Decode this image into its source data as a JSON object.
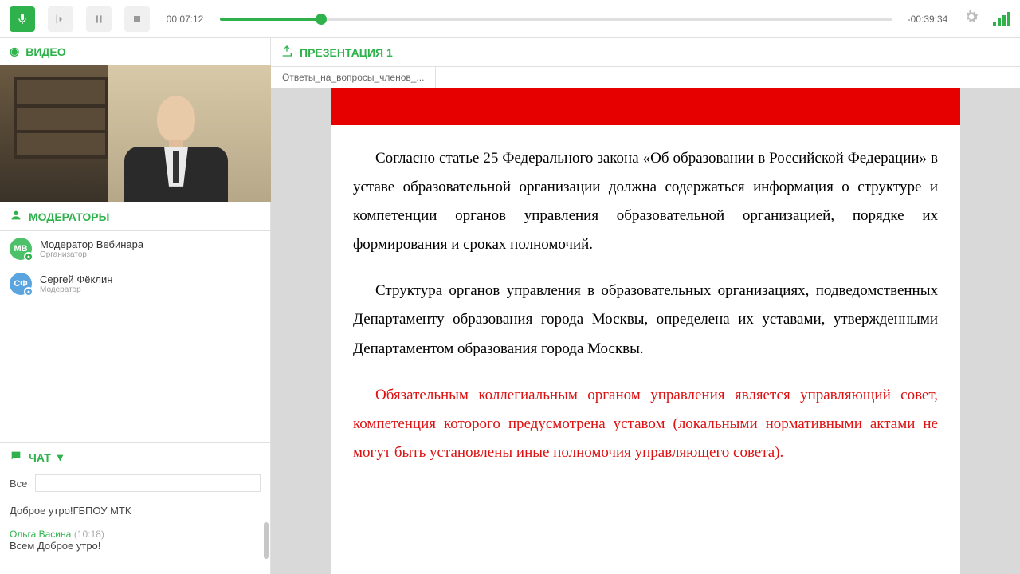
{
  "topbar": {
    "elapsed": "00:07:12",
    "remaining": "-00:39:34"
  },
  "video": {
    "title": "ВИДЕО"
  },
  "moderators": {
    "title": "МОДЕРАТОРЫ",
    "items": [
      {
        "avatar": "МВ",
        "name": "Модератор Вебинара",
        "role": "Организатор",
        "color": "#4cc16a"
      },
      {
        "avatar": "СФ",
        "name": "Сергей Фёклин",
        "role": "Модератор",
        "color": "#5aa4e0"
      }
    ]
  },
  "chat": {
    "title": "ЧАТ",
    "filter": "Все",
    "msg1": "Доброе утро!ГБПОУ МТК",
    "user2": "Ольга Васина",
    "time2": "(10:18)",
    "msg2": "Всем Доброе утро!"
  },
  "presentation": {
    "title": "ПРЕЗЕНТАЦИЯ 1",
    "tab": "Ответы_на_вопросы_членов_...",
    "para1": "Согласно статье 25 Федерального закона «Об образовании в Российской Федерации» в уставе образовательной организации должна содержаться информация о структуре и компетенции органов управления образовательной организацией, порядке их формирования и сроках полномочий.",
    "para2": "Структура органов управления в образовательных организациях, подведомственных Департаменту образования города Москвы, определена их уставами, утвержденными Департаментом образования города Москвы.",
    "para3": "Обязательным коллегиальным органом управления является управляющий совет, компетенция которого предусмотрена уставом (локальными нормативными актами не могут быть установлены иные полномочия управляющего совета)."
  }
}
